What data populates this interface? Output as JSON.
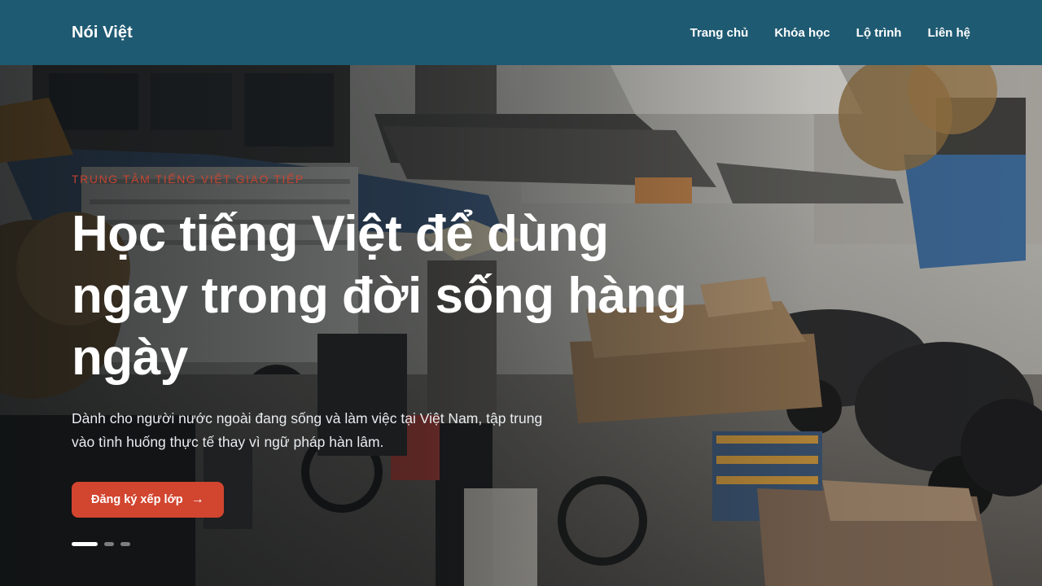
{
  "header": {
    "brand": "Nói Việt",
    "nav": [
      {
        "label": "Trang chủ"
      },
      {
        "label": "Khóa học"
      },
      {
        "label": "Lộ trình"
      },
      {
        "label": "Liên hệ"
      }
    ]
  },
  "hero": {
    "eyebrow": "TRUNG TÂM TIẾNG VIỆT GIAO TIẾP",
    "headline": "Học tiếng Việt để dùng ngay trong đời sống hàng ngày",
    "lead": "Dành cho người nước ngoài đang sống và làm việc tại Việt Nam, tập trung vào tình huống thực tế thay vì ngữ pháp hàn lâm.",
    "cta_label": "Đăng ký xếp lớp",
    "cta_icon": "arrow-right-icon",
    "slides": {
      "count": 3,
      "active": 1
    }
  },
  "colors": {
    "header_bg": "#1e5a72",
    "accent": "#d2452f",
    "text": "#ffffff"
  }
}
